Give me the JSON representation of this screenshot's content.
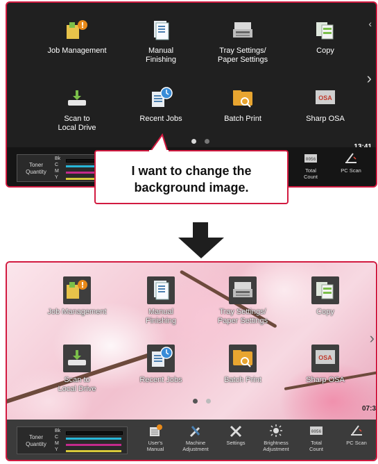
{
  "top_screen": {
    "tiles": [
      {
        "label": "Job Management",
        "icon": "job-management-icon"
      },
      {
        "label": "Manual\nFinishing",
        "icon": "manual-finishing-icon"
      },
      {
        "label": "Tray Settings/\nPaper Settings",
        "icon": "tray-settings-icon"
      },
      {
        "label": "Copy",
        "icon": "copy-icon"
      },
      {
        "label": "Scan to\nLocal Drive",
        "icon": "scan-local-drive-icon"
      },
      {
        "label": "Recent Jobs",
        "icon": "recent-jobs-icon"
      },
      {
        "label": "Batch Print",
        "icon": "batch-print-icon"
      },
      {
        "label": "Sharp OSA",
        "icon": "sharp-osa-icon"
      }
    ],
    "clock": "13:41",
    "toner_title": "Toner\nQuantity",
    "toner_rows": [
      {
        "label": "Bk",
        "color": "#111111"
      },
      {
        "label": "C",
        "color": "#27b6d8"
      },
      {
        "label": "M",
        "color": "#c42a8c"
      },
      {
        "label": "Y",
        "color": "#d6c83a"
      }
    ],
    "bar_buttons": [
      {
        "label": "Total\nCount",
        "icon": "total-count-icon"
      },
      {
        "label": "PC Scan",
        "icon": "pc-scan-icon"
      }
    ]
  },
  "bubble_text": "I want to change the\nbackground image.",
  "bottom_screen": {
    "tiles": [
      {
        "label": "Job Management",
        "icon": "job-management-icon"
      },
      {
        "label": "Manual\nFinishing",
        "icon": "manual-finishing-icon"
      },
      {
        "label": "Tray Settings/\nPaper Settings",
        "icon": "tray-settings-icon"
      },
      {
        "label": "Copy",
        "icon": "copy-icon"
      },
      {
        "label": "Scan to\nLocal Drive",
        "icon": "scan-local-drive-icon"
      },
      {
        "label": "Recent Jobs",
        "icon": "recent-jobs-icon"
      },
      {
        "label": "Batch Print",
        "icon": "batch-print-icon"
      },
      {
        "label": "Sharp OSA",
        "icon": "sharp-osa-icon"
      }
    ],
    "clock": "07:3",
    "toner_title": "Toner\nQuantity",
    "toner_rows": [
      {
        "label": "Bk",
        "color": "#111111"
      },
      {
        "label": "C",
        "color": "#27b6d8"
      },
      {
        "label": "M",
        "color": "#c42a8c"
      },
      {
        "label": "Y",
        "color": "#d6c83a"
      }
    ],
    "bar_buttons": [
      {
        "label": "User's\nManual",
        "icon": "users-manual-icon"
      },
      {
        "label": "Machine\nAdjustment",
        "icon": "machine-adjustment-icon"
      },
      {
        "label": "Settings",
        "icon": "settings-icon"
      },
      {
        "label": "Brightness\nAdjustment",
        "icon": "brightness-adjustment-icon"
      },
      {
        "label": "Total\nCount",
        "icon": "total-count-icon"
      },
      {
        "label": "PC Scan",
        "icon": "pc-scan-icon"
      }
    ]
  }
}
